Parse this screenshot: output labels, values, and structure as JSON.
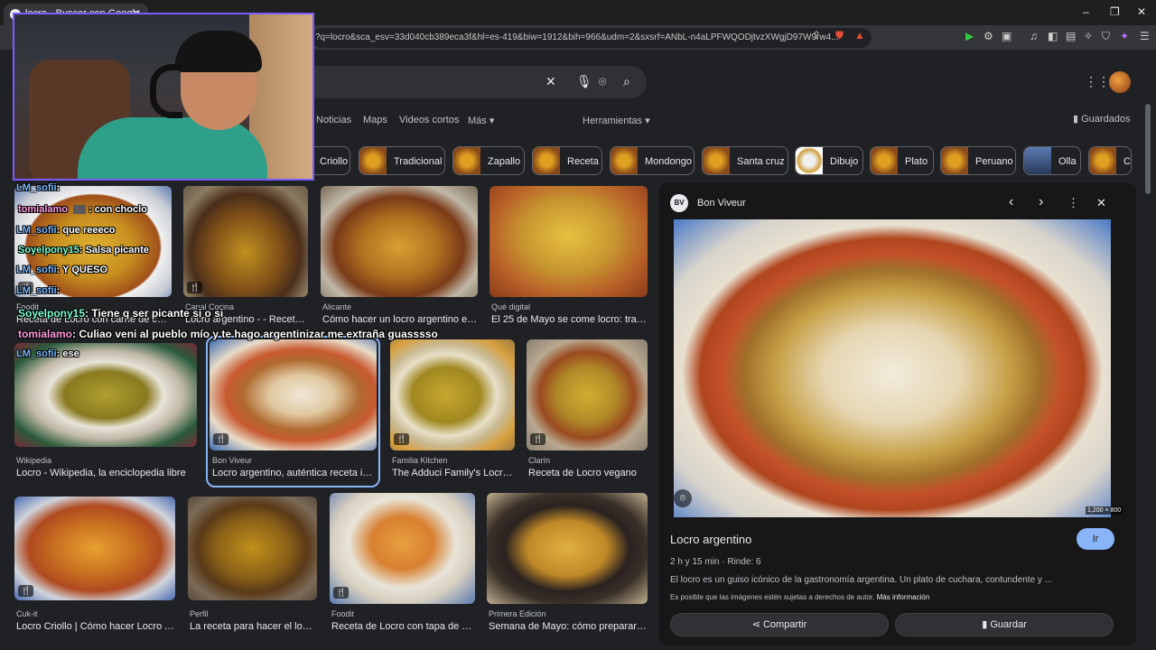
{
  "browser": {
    "tab_title": "locro - Buscar con Google",
    "url": "?q=locro&sca_esv=33d040cb389eca3f&hl=es-419&biw=1912&bih=966&udm=2&sxsrf=ANbL-n4aLPFWQODjtvzXWgjD97W9rw4..."
  },
  "nav": {
    "tabs": [
      "Noticias",
      "Maps",
      "Videos cortos",
      "Más ▾"
    ],
    "tools": "Herramientas ▾",
    "saved": "Guardados"
  },
  "chips": [
    "Criollo",
    "Tradicional",
    "Zapallo",
    "Receta",
    "Mondongo",
    "Santa cruz",
    "Dibujo",
    "Plato",
    "Peruano",
    "Olla",
    "C"
  ],
  "results": [
    {
      "source": "Foodit",
      "title": "Receta de Locro con carne de cerdo ..."
    },
    {
      "source": "Canal Cocina",
      "title": "Locro argentino - - Receta - ..."
    },
    {
      "source": "Alicante",
      "title": "Cómo hacer un locro argentino exqui..."
    },
    {
      "source": "Qué digital",
      "title": "El 25 de Mayo se come locro: tradici..."
    },
    {
      "source": "Wikipedia",
      "title": "Locro - Wikipedia, la enciclopedia libre"
    },
    {
      "source": "Bon Viveur",
      "title": "Locro argentino, auténtica receta icónic..."
    },
    {
      "source": "Familia Kitchen",
      "title": "The Adduci Family's Locro f..."
    },
    {
      "source": "Clarín",
      "title": "Receta de Locro vegano"
    },
    {
      "source": "Cuk-it",
      "title": "Locro Criollo | Cómo hacer Locro Arge..."
    },
    {
      "source": "Perfil",
      "title": "La receta para hacer el locro t..."
    },
    {
      "source": "Foodit",
      "title": "Receta de Locro con tapa de asa..."
    },
    {
      "source": "Primera Edición",
      "title": "Semana de Mayo: cómo preparar un ..."
    }
  ],
  "panel": {
    "logo": "BV",
    "source": "Bon Viveur",
    "dimensions": "1,200 × 800",
    "title": "Locro argentino",
    "visit": "Ir",
    "meta": "2 h y 15 min  ·  Rinde: 6",
    "description": "El locro es un guiso icónico de la gastronomía argentina. Un plato de cuchara, contundente y ...",
    "rights_note": "Es posible que las imágenes estén sujetas a derechos de autor.",
    "rights_link": "Más información",
    "share": "Compartir",
    "save": "Guardar"
  },
  "chat": [
    {
      "user": "LM_sofii",
      "message": ":"
    },
    {
      "user": "tomialamo",
      "message": ": con choclo"
    },
    {
      "user": "LM_sofii",
      "message": ": que reeeco"
    },
    {
      "user": "Soyelpony15",
      "message": ": Salsa picante"
    },
    {
      "user": "LM_sofii",
      "message": ": Y QUESO"
    },
    {
      "user": "LM_sofii",
      "message": ":"
    },
    {
      "user": "Soyelpony15",
      "message": ": Tiene q ser picante si o si"
    },
    {
      "user": "tomialamo",
      "message": ": Culiao veni al pueblo mío y te hago argentinizar me extraña guasssso"
    },
    {
      "user": "LM_sofii",
      "message": ": ese"
    }
  ]
}
